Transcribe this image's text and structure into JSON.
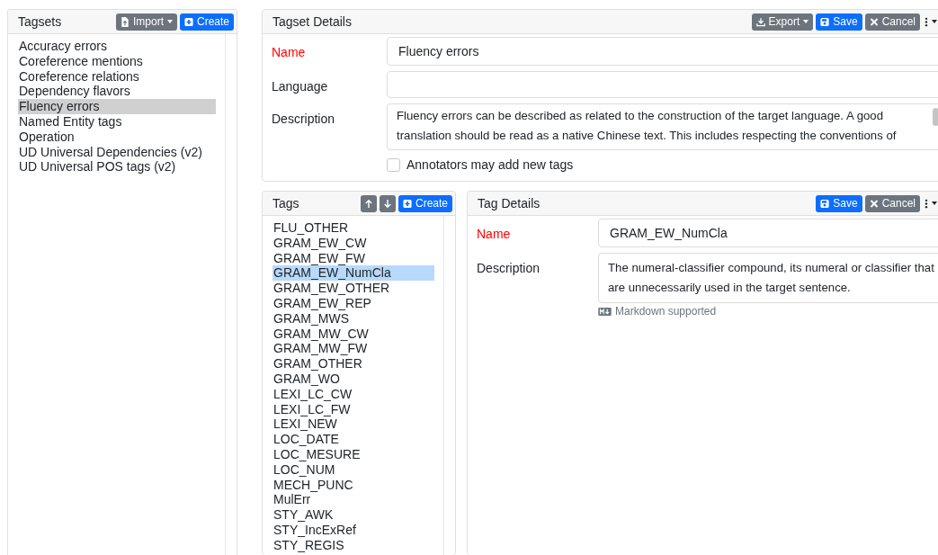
{
  "tagsets": {
    "title": "Tagsets",
    "buttons": [
      {
        "kind": "import",
        "label": "Import",
        "dropdown": true
      },
      {
        "kind": "create",
        "label": "Create",
        "dropdown": false
      }
    ],
    "items": [
      {
        "label": "Accuracy errors",
        "selected": false
      },
      {
        "label": "Coreference mentions",
        "selected": false
      },
      {
        "label": "Coreference relations",
        "selected": false
      },
      {
        "label": "Dependency flavors",
        "selected": false
      },
      {
        "label": "Fluency errors",
        "selected": true
      },
      {
        "label": "Named Entity tags",
        "selected": false
      },
      {
        "label": "Operation",
        "selected": false
      },
      {
        "label": "UD Universal Dependencies (v2)",
        "selected": false
      },
      {
        "label": "UD Universal POS tags (v2)",
        "selected": false
      }
    ]
  },
  "tagset_details": {
    "title": "Tagset Details",
    "buttons": [
      {
        "kind": "export",
        "label": "Export",
        "dropdown": true
      },
      {
        "kind": "save",
        "label": "Save",
        "dropdown": false
      },
      {
        "kind": "cancel",
        "label": "Cancel",
        "dropdown": false
      },
      {
        "kind": "menu",
        "dropdown": true
      }
    ],
    "name": {
      "label": "Name",
      "required": true,
      "value": "Fluency errors"
    },
    "language": {
      "label": "Language",
      "required": false
    },
    "description": {
      "label": "Description",
      "value": "Fluency errors can be described as related to the construction of the target language. A good translation should be read as a native Chinese text. This includes respecting the conventions of"
    },
    "checkbox": {
      "label": "Annotators may add new tags",
      "checked": false
    }
  },
  "tags": {
    "title": "Tags",
    "buttons": [
      {
        "kind": "up",
        "dropdown": false
      },
      {
        "kind": "down",
        "dropdown": false
      },
      {
        "kind": "create",
        "label": "Create",
        "dropdown": false
      }
    ],
    "items": [
      {
        "label": "FLU_OTHER",
        "selected": false
      },
      {
        "label": "GRAM_EW_CW",
        "selected": false
      },
      {
        "label": "GRAM_EW_FW",
        "selected": false
      },
      {
        "label": "GRAM_EW_NumCla",
        "selected": true
      },
      {
        "label": "GRAM_EW_OTHER",
        "selected": false
      },
      {
        "label": "GRAM_EW_REP",
        "selected": false
      },
      {
        "label": "GRAM_MWS",
        "selected": false
      },
      {
        "label": "GRAM_MW_CW",
        "selected": false
      },
      {
        "label": "GRAM_MW_FW",
        "selected": false
      },
      {
        "label": "GRAM_OTHER",
        "selected": false
      },
      {
        "label": "GRAM_WO",
        "selected": false
      },
      {
        "label": "LEXI_LC_CW",
        "selected": false
      },
      {
        "label": "LEXI_LC_FW",
        "selected": false
      },
      {
        "label": "LEXI_NEW",
        "selected": false
      },
      {
        "label": "LOC_DATE",
        "selected": false
      },
      {
        "label": "LOC_MESURE",
        "selected": false
      },
      {
        "label": "LOC_NUM",
        "selected": false
      },
      {
        "label": "MECH_PUNC",
        "selected": false
      },
      {
        "label": "MulErr",
        "selected": false
      },
      {
        "label": "STY_AWK",
        "selected": false
      },
      {
        "label": "STY_IncExRef",
        "selected": false
      },
      {
        "label": "STY_REGIS",
        "selected": false
      }
    ]
  },
  "tag_details": {
    "title": "Tag Details",
    "buttons": [
      {
        "kind": "save",
        "label": "Save",
        "dropdown": false
      },
      {
        "kind": "cancel",
        "label": "Cancel",
        "dropdown": false
      },
      {
        "kind": "menu",
        "dropdown": true
      }
    ],
    "name": {
      "label": "Name",
      "required": true,
      "value": "GRAM_EW_NumCla"
    },
    "description": {
      "label": "Description",
      "value": "The numeral-classifier compound, its numeral or classifier that are unnecessarily used in the target sentence."
    },
    "hint": "Markdown supported"
  }
}
